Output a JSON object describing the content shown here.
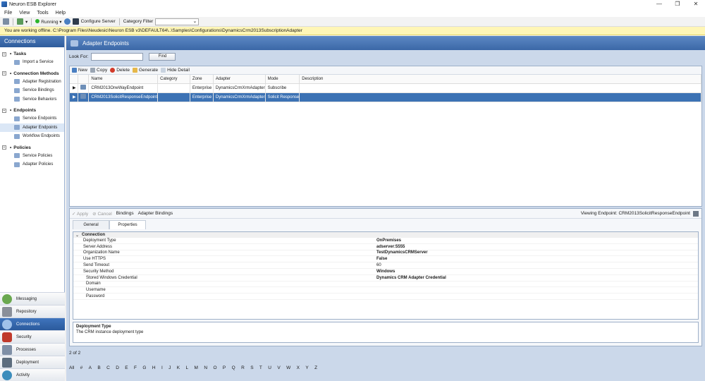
{
  "window": {
    "title": "Neuron ESB Explorer",
    "controls": [
      "—",
      "❐",
      "✕"
    ]
  },
  "menu": [
    "File",
    "View",
    "Tools",
    "Help"
  ],
  "toolbar": {
    "status": "Running",
    "configure_server": "Configure Server",
    "category_filter": "Category Filter",
    "category_value": ""
  },
  "offline_message": "You are working offline. C:\\Program Files\\Neudesic\\Neuron ESB v3\\DEFAULT64\\..\\Samples\\Configurations\\DynamicsCrm2013SubscriptionAdapter",
  "sidebar": {
    "header": "Connections",
    "sections": [
      {
        "title": "Tasks",
        "items": [
          "Import a Service"
        ]
      },
      {
        "title": "Connection Methods",
        "items": [
          "Adapter Registration",
          "Service Bindings",
          "Service Behaviors"
        ]
      },
      {
        "title": "Endpoints",
        "items": [
          "Service Endpoints",
          "Adapter Endpoints",
          "Workflow Endpoints"
        ]
      },
      {
        "title": "Policies",
        "items": [
          "Service Policies",
          "Adapter Policies"
        ]
      }
    ],
    "selected_item": "Adapter Endpoints",
    "nav": [
      "Messaging",
      "Repository",
      "Connections",
      "Security",
      "Processes",
      "Deployment",
      "Activity"
    ],
    "active_nav": "Connections"
  },
  "main": {
    "title": "Adapter Endpoints",
    "look_for_label": "Look For:",
    "look_for_value": "",
    "find_label": "Find",
    "grid_toolbar": [
      "New",
      "Copy",
      "Delete",
      "Generate",
      "Hide Detail"
    ],
    "columns": [
      "Name",
      "Category",
      "Zone",
      "Adapter",
      "Mode",
      "Description"
    ],
    "rows": [
      {
        "name": "CRM2013OneWayEndpoint",
        "category": "",
        "zone": "Enterprise",
        "adapter": "DynamicsCrmXrmAdapter",
        "mode": "Subscribe",
        "description": ""
      },
      {
        "name": "CRM2013SolicitResponseEndpoint",
        "category": "",
        "zone": "Enterprise",
        "adapter": "DynamicsCrmXrmAdapter",
        "mode": "Solicit Response",
        "description": ""
      }
    ],
    "selected_row": 1
  },
  "detail": {
    "toolbar": {
      "apply": "Apply",
      "cancel": "Cancel",
      "bindings": "Bindings",
      "adapter_bindings": "Adapter Bindings",
      "viewing": "Viewing Endpoint: CRM2013SolicitResponseEndpoint"
    },
    "tabs": [
      "General",
      "Properties"
    ],
    "active_tab": "Properties",
    "category": "Connection",
    "properties": [
      {
        "name": "Deployment Type",
        "value": "OnPremises",
        "bold": true
      },
      {
        "name": "Server Address",
        "value": "adserver:5555",
        "bold": true
      },
      {
        "name": "Organization Name",
        "value": "TestDynamicsCRMServer",
        "bold": true
      },
      {
        "name": "Use HTTPS",
        "value": "False",
        "bold": true
      },
      {
        "name": "Send Timeout",
        "value": "60",
        "bold": false
      },
      {
        "name": "Security Method",
        "value": "Windows",
        "bold": true
      },
      {
        "name": "Stored Windows Credential",
        "value": "Dynamics CRM Adapter Credential",
        "bold": true,
        "sub": true
      },
      {
        "name": "Domain",
        "value": "",
        "bold": false,
        "sub": true
      },
      {
        "name": "Username",
        "value": "",
        "bold": false,
        "sub": true
      },
      {
        "name": "Password",
        "value": "",
        "bold": false,
        "sub": true
      }
    ],
    "description_title": "Deployment Type",
    "description_text": "The CRM instance deployment type"
  },
  "page_count": "2 of 2",
  "alphabet": [
    "All",
    "#",
    "A",
    "B",
    "C",
    "D",
    "E",
    "F",
    "G",
    "H",
    "I",
    "J",
    "K",
    "L",
    "M",
    "N",
    "O",
    "P",
    "Q",
    "R",
    "S",
    "T",
    "U",
    "V",
    "W",
    "X",
    "Y",
    "Z"
  ],
  "colors": {
    "accent": "#3c72b4",
    "offline_bar": "#fff6b6",
    "running": "#2bb52b"
  }
}
